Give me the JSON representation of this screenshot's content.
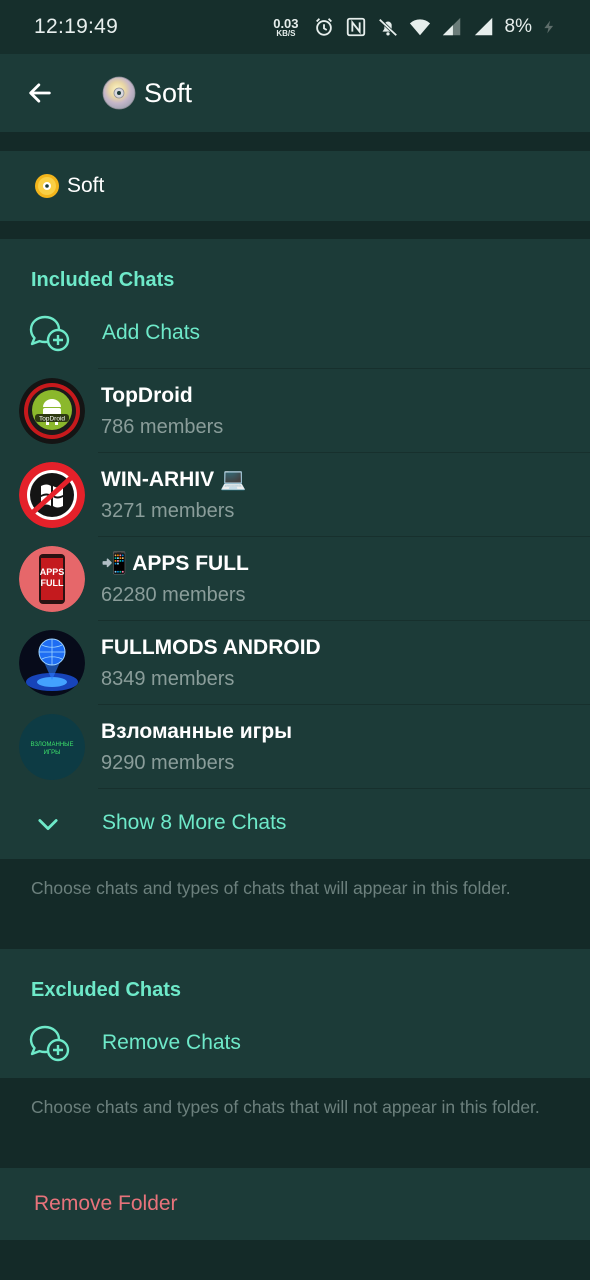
{
  "status_bar": {
    "time": "12:19:49",
    "net_speed_value": "0.03",
    "net_speed_unit": "KB/S",
    "battery": "8%",
    "icons": [
      "alarm-icon",
      "nfc-icon",
      "mute-icon",
      "wifi-icon",
      "signal-icon",
      "signal-icon",
      "charging-icon"
    ]
  },
  "app_bar": {
    "title": "Soft",
    "title_icon": "cd-disc-icon"
  },
  "folder_name": {
    "value": "Soft",
    "icon": "dvd-disc-icon"
  },
  "included": {
    "header": "Included Chats",
    "add_label": "Add Chats",
    "chats": [
      {
        "name": "TopDroid",
        "subtitle": "786 members",
        "avatar_text": "TopDroid"
      },
      {
        "name": "WIN-ARHIV 💻",
        "subtitle": "3271 members",
        "avatar_text": ""
      },
      {
        "name": "📲 APPS FULL",
        "subtitle": "62280 members",
        "avatar_text": "APPS FULL"
      },
      {
        "name": "FULLMODS ANDROID",
        "subtitle": "8349 members",
        "avatar_text": ""
      },
      {
        "name": "Взломанные игры",
        "subtitle": "9290 members",
        "avatar_text": "ВЗЛОМАННЫЕ ИГРЫ"
      }
    ],
    "show_more_label": "Show 8 More Chats",
    "hint": "Choose chats and types of chats that will appear in this folder."
  },
  "excluded": {
    "header": "Excluded Chats",
    "remove_label": "Remove Chats",
    "hint": "Choose chats and types of chats that will not appear in this folder."
  },
  "remove_folder_label": "Remove Folder",
  "colors": {
    "accent": "#6ee9c9",
    "danger": "#e8737b",
    "card": "#1c3b38",
    "background": "#142a28"
  }
}
